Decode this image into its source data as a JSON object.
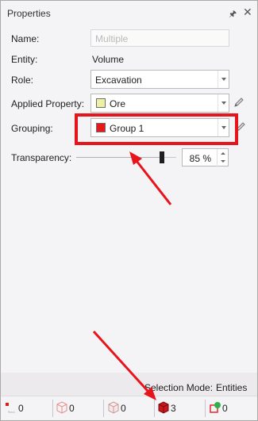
{
  "panel": {
    "title": "Properties",
    "pin_icon": "pin-icon",
    "close_icon": "close-icon"
  },
  "fields": {
    "name_label": "Name:",
    "name_placeholder": "Multiple",
    "entity_label": "Entity:",
    "entity_value": "Volume",
    "role_label": "Role:",
    "role_value": "Excavation",
    "applied_property_label": "Applied Property:",
    "applied_property_value": "Ore",
    "applied_property_color": "#eef0a6",
    "grouping_label": "Grouping:",
    "grouping_value": "Group 1",
    "grouping_color": "#e31b1b",
    "transparency_label": "Transparency:",
    "transparency_value": "85 %",
    "transparency_fraction": 0.85
  },
  "selection_mode": {
    "label": "Selection Mode:",
    "value": "Entities"
  },
  "status": {
    "vertices": "0",
    "edges": "0",
    "faces": "0",
    "volumes": "3",
    "other": "0"
  },
  "annotations": {
    "highlight_color": "#e8141b"
  }
}
